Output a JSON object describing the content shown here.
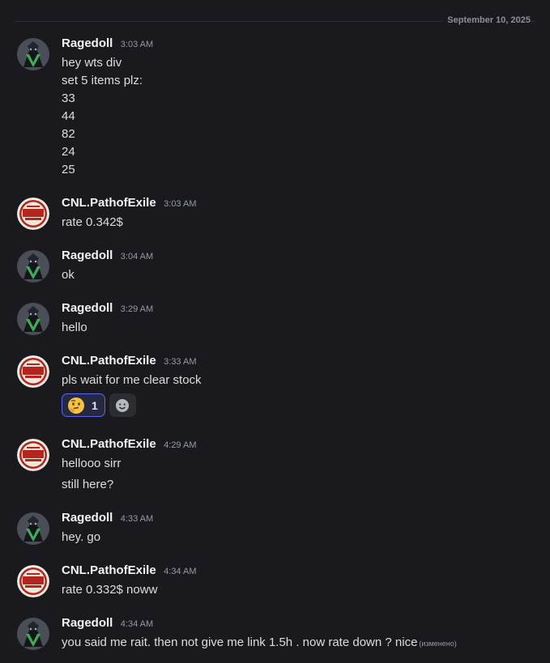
{
  "date_divider": "September 10, 2025",
  "colors": {
    "background": "#1a1a1e",
    "text": "#dbdee1",
    "muted": "#949ba4",
    "reaction_accent": "#5865f2"
  },
  "icons": {
    "ragedoll_avatar": "dark-hooded-figure-green-v-avatar",
    "cnl_avatar": "cnl-red-badge-logo",
    "reaction_emoji": "thinking-face-emoji",
    "add_reaction": "smiley-plus-icon"
  },
  "messages": [
    {
      "author": "Ragedoll",
      "time": "3:03 AM",
      "lines": [
        "hey wts div",
        "set 5 items plz:",
        "33",
        "44",
        "82",
        "24",
        "25"
      ]
    },
    {
      "author": "CNL.PathofExile",
      "time": "3:03 AM",
      "lines": [
        "rate 0.342$"
      ]
    },
    {
      "author": "Ragedoll",
      "time": "3:04 AM",
      "lines": [
        "ok"
      ]
    },
    {
      "author": "Ragedoll",
      "time": "3:29 AM",
      "lines": [
        "hello"
      ]
    },
    {
      "author": "CNL.PathofExile",
      "time": "3:33 AM",
      "lines": [
        "pls wait for me clear stock"
      ],
      "reaction_count": "1"
    },
    {
      "author": "CNL.PathofExile",
      "time": "4:29 AM",
      "lines": [
        "hellooo sirr",
        "still here?"
      ]
    },
    {
      "author": "Ragedoll",
      "time": "4:33 AM",
      "lines": [
        "hey. go"
      ]
    },
    {
      "author": "CNL.PathofExile",
      "time": "4:34 AM",
      "lines": [
        "rate 0.332$ noww"
      ]
    },
    {
      "author": "Ragedoll",
      "time": "4:34 AM",
      "lines": [
        "you said me rait. then not give me link 1.5h . now rate down ? nice"
      ],
      "edited_label": "(изменено)"
    }
  ]
}
